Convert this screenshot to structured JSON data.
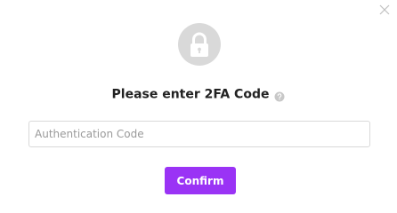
{
  "dialog": {
    "title": "Please enter 2FA Code",
    "close_icon": "close-icon",
    "lock_icon": "lock-icon",
    "help_icon": "question-circle-icon",
    "code_input": {
      "value": "",
      "placeholder": "Authentication Code"
    },
    "confirm_label": "Confirm"
  },
  "colors": {
    "accent": "#9a33f5",
    "lock_circle_bg": "#d9d9d9",
    "lock_icon": "#ffffff",
    "input_border": "#d9d9d9",
    "title_text": "#222222",
    "placeholder_text": "#9a9a9a",
    "close_icon": "#c0c0c0",
    "help_icon_bg": "#c8c8c8"
  }
}
